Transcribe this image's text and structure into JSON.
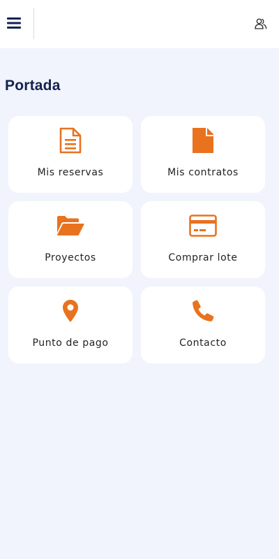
{
  "header": {
    "menu_icon": "hamburger-menu-icon",
    "user_icon": "users-icon"
  },
  "page": {
    "title": "Portada"
  },
  "colors": {
    "accent": "#e8721e",
    "title": "#14214f",
    "background": "#f1f4fd",
    "card": "#ffffff"
  },
  "cards": [
    {
      "label": "Mis reservas",
      "icon": "document-lines-icon"
    },
    {
      "label": "Mis contratos",
      "icon": "file-solid-icon"
    },
    {
      "label": "Proyectos",
      "icon": "folder-open-icon"
    },
    {
      "label": "Comprar lote",
      "icon": "credit-card-icon"
    },
    {
      "label": "Punto de pago",
      "icon": "map-pin-icon"
    },
    {
      "label": "Contacto",
      "icon": "phone-icon"
    }
  ]
}
